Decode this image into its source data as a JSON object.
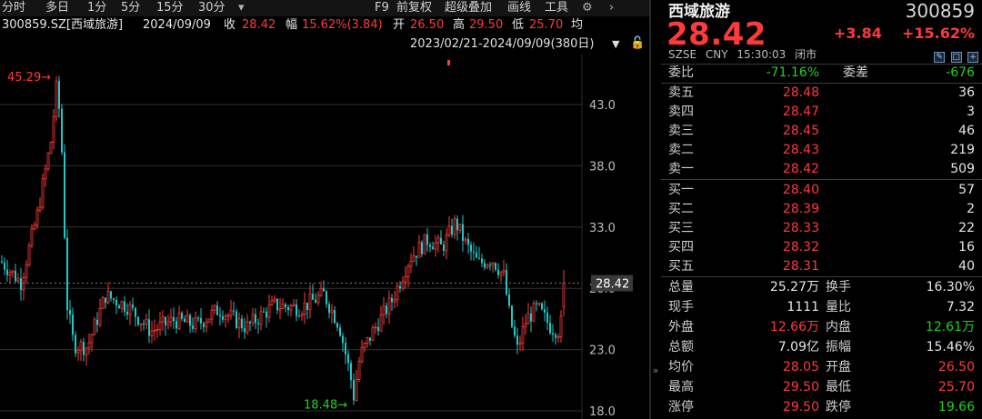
{
  "toolbar": {
    "periods": [
      "分时",
      "多日",
      "1分",
      "5分",
      "15分",
      "30分"
    ],
    "dropdown_icon": "▾",
    "right_items": [
      "F9",
      "前复权",
      "超级叠加",
      "画线",
      "工具"
    ],
    "settings_icon": "⚙",
    "next_icon": "›"
  },
  "infoline": {
    "code": "300859.SZ[西域旅游]",
    "date": "2024/09/09",
    "close_label": "收",
    "close": "28.42",
    "amp_label": "幅",
    "amp": "15.62%(3.84)",
    "open_label": "开",
    "open": "26.50",
    "high_label": "高",
    "high": "29.50",
    "low_label": "低",
    "low": "25.70",
    "avg_label": "均"
  },
  "range": {
    "text": "2023/02/21-2024/09/09(380日)",
    "arrow": "▼",
    "lock": "🔓"
  },
  "chart_data": {
    "type": "candlestick",
    "y_axis_ticks": [
      "43.0",
      "38.0",
      "33.0",
      "28.0",
      "23.0",
      "18.0"
    ],
    "ylim": [
      18.0,
      47.4
    ],
    "current_price_label": "28.42",
    "current_price": 28.42,
    "max_marker": "45.29→",
    "max_value": 45.29,
    "min_marker": "18.48→",
    "min_value": 18.48,
    "colors": {
      "up": "#ff3a3a",
      "down": "#20c8c8",
      "grid": "#303030",
      "price_line": "#7a7a7a"
    }
  },
  "side_collapse": "»",
  "quote": {
    "name": "西域旅游",
    "code": "300859",
    "price": "28.42",
    "change": "+3.84",
    "change_pct": "+15.62%",
    "market": "SZSE",
    "currency": "CNY",
    "time": "15:30:03",
    "status": "闭市",
    "icons": [
      "✎",
      "□",
      "+"
    ],
    "weibi_label": "委比",
    "weibi": "-71.16%",
    "weicha_label": "委差",
    "weicha": "-676",
    "asks": [
      {
        "label": "卖五",
        "price": "28.48",
        "vol": "36"
      },
      {
        "label": "卖四",
        "price": "28.47",
        "vol": "3"
      },
      {
        "label": "卖三",
        "price": "28.45",
        "vol": "46"
      },
      {
        "label": "卖二",
        "price": "28.43",
        "vol": "219"
      },
      {
        "label": "卖一",
        "price": "28.42",
        "vol": "509"
      }
    ],
    "bids": [
      {
        "label": "买一",
        "price": "28.40",
        "vol": "57"
      },
      {
        "label": "买二",
        "price": "28.39",
        "vol": "2"
      },
      {
        "label": "买三",
        "price": "28.33",
        "vol": "22"
      },
      {
        "label": "买四",
        "price": "28.32",
        "vol": "16"
      },
      {
        "label": "买五",
        "price": "28.31",
        "vol": "40"
      }
    ],
    "stats": [
      {
        "l": "总量",
        "lv": "25.27万",
        "r": "换手",
        "rv": "16.30%",
        "lc": "",
        "rc": ""
      },
      {
        "l": "现手",
        "lv": "1111",
        "r": "量比",
        "rv": "7.32",
        "lc": "",
        "rc": ""
      },
      {
        "l": "外盘",
        "lv": "12.66万",
        "r": "内盘",
        "rv": "12.61万",
        "lc": "red",
        "rc": "green"
      },
      {
        "l": "总额",
        "lv": "7.09亿",
        "r": "振幅",
        "rv": "15.46%",
        "lc": "",
        "rc": ""
      },
      {
        "l": "均价",
        "lv": "28.05",
        "r": "开盘",
        "rv": "26.50",
        "lc": "red",
        "rc": "red"
      },
      {
        "l": "最高",
        "lv": "29.50",
        "r": "最低",
        "rv": "25.70",
        "lc": "red",
        "rc": "red"
      },
      {
        "l": "涨停",
        "lv": "29.50",
        "r": "跌停",
        "rv": "19.66",
        "lc": "red",
        "rc": "green"
      }
    ]
  }
}
